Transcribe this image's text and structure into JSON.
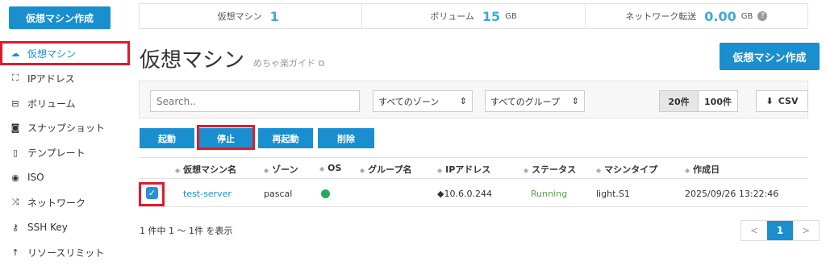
{
  "sidebar": {
    "create_button": "仮想マシン作成",
    "items": [
      {
        "label": "仮想マシン",
        "icon": "cloud-icon"
      },
      {
        "label": "IPアドレス",
        "icon": "network-tree-icon"
      },
      {
        "label": "ボリューム",
        "icon": "drive-icon"
      },
      {
        "label": "スナップショット",
        "icon": "camera-icon"
      },
      {
        "label": "テンプレート",
        "icon": "file-icon"
      },
      {
        "label": "ISO",
        "icon": "disc-icon"
      },
      {
        "label": "ネットワーク",
        "icon": "shuffle-icon"
      },
      {
        "label": "SSH Key",
        "icon": "key-icon"
      },
      {
        "label": "リソースリミット",
        "icon": "up-arrow-icon"
      }
    ]
  },
  "stats": {
    "vm_label": "仮想マシン",
    "vm_value": "1",
    "volume_label": "ボリューム",
    "volume_value": "15",
    "volume_unit": "GB",
    "network_label": "ネットワーク転送",
    "network_value": "0.00",
    "network_unit": "GB"
  },
  "header": {
    "title": "仮想マシン",
    "guide": "めちゃ楽ガイド",
    "create_button": "仮想マシン作成"
  },
  "filter": {
    "search_placeholder": "Search..",
    "zone_select": "すべてのゾーン",
    "group_select": "すべてのグループ",
    "page_size_20": "20件",
    "page_size_100": "100件",
    "csv": "CSV"
  },
  "actions": {
    "start": "起動",
    "stop": "停止",
    "restart": "再起動",
    "delete": "削除"
  },
  "table": {
    "headers": [
      "仮想マシン名",
      "ゾーン",
      "OS",
      "グループ名",
      "IPアドレス",
      "ステータス",
      "マシンタイプ",
      "作成日"
    ],
    "rows": [
      {
        "name": "test-server",
        "zone": "pascal",
        "os": "",
        "group": "",
        "ip": "10.6.0.244",
        "status": "Running",
        "type": "light.S1",
        "created": "2025/09/26 13:22:46"
      }
    ]
  },
  "footer": {
    "count": "1 件中 1 ～ 1件 を表示",
    "prev": "<",
    "page": "1",
    "next": ">"
  },
  "colors": {
    "accent": "#1a8fcf",
    "highlight": "#e11a2b",
    "running": "#5aa54a"
  }
}
